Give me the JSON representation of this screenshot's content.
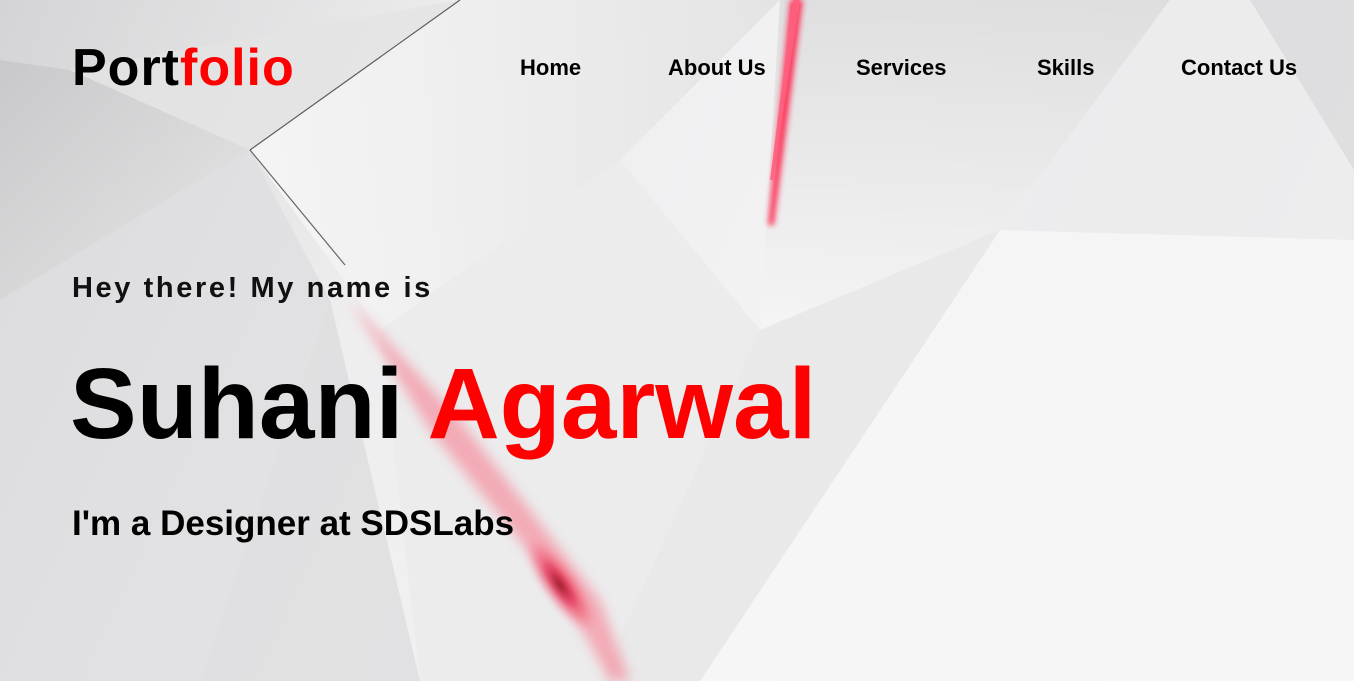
{
  "header": {
    "logo_main": "Port",
    "logo_accent": "folio"
  },
  "nav": {
    "items": [
      {
        "label": "Home"
      },
      {
        "label": "About Us"
      },
      {
        "label": "Services"
      },
      {
        "label": "Skills"
      },
      {
        "label": "Contact Us"
      }
    ]
  },
  "hero": {
    "greeting": "Hey there! My name is",
    "first_name": "Suhani",
    "last_name": "Agarwal",
    "tagline": "I'm a Designer at SDSLabs"
  },
  "colors": {
    "accent": "#ff0000",
    "text": "#000000",
    "background": "#f0f0f0"
  }
}
